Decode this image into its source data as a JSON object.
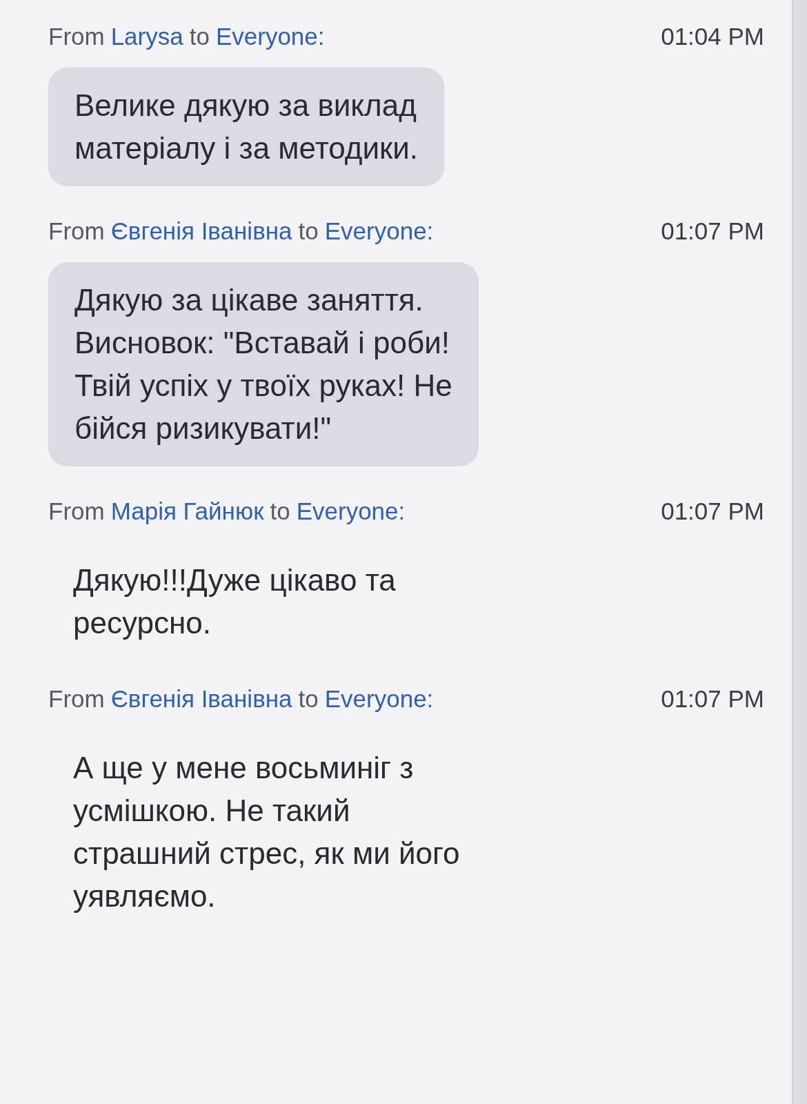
{
  "messages": [
    {
      "from_label": "From",
      "sender": "Larysa",
      "to_label": "to",
      "recipient": "Everyone:",
      "time": "01:04 PM",
      "kind": "bubble",
      "lines": [
        "Велике дякую за виклад",
        "матеріалу і за методики."
      ]
    },
    {
      "from_label": "From",
      "sender": "Євгенія Іванівна",
      "to_label": "to",
      "recipient": "Everyone:",
      "time": "01:07 PM",
      "kind": "bubble",
      "lines": [
        "Дякую за цікаве заняття.",
        "Висновок: \"Вставай і роби!",
        "Твій успіх у твоїх руках! Не",
        "бійся ризикувати!\""
      ]
    },
    {
      "from_label": "From",
      "sender": "Марія Гайнюк",
      "to_label": "to",
      "recipient": "Everyone:",
      "time": "01:07 PM",
      "kind": "plain",
      "lines": [
        "Дякую!!!Дуже цікаво та",
        "ресурсно."
      ]
    },
    {
      "from_label": "From",
      "sender": "Євгенія Іванівна",
      "to_label": "to",
      "recipient": "Everyone:",
      "time": "01:07 PM",
      "kind": "plain",
      "lines": [
        "А ще у мене восьминіг з",
        "усмішкою. Не такий",
        "страшний стрес, як ми його",
        "уявляємо."
      ]
    }
  ]
}
